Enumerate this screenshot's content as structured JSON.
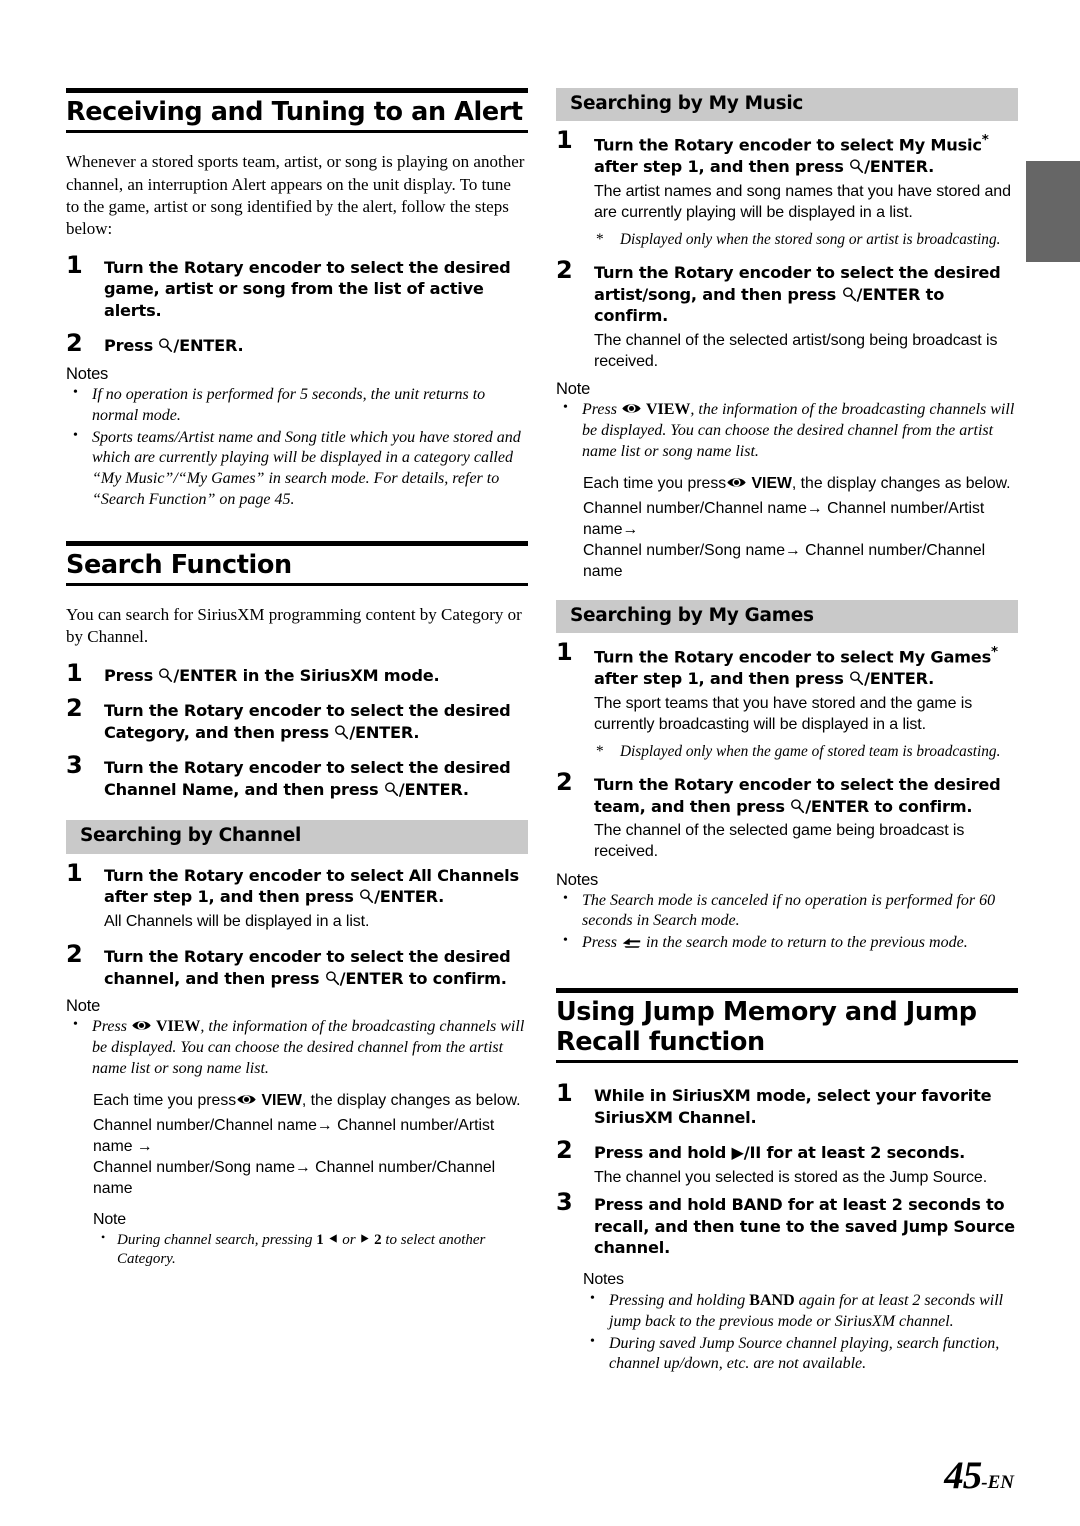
{
  "page": {
    "number": "45",
    "suffix": "-EN"
  },
  "left_column": {
    "chapter_alert": {
      "title": "Receiving and Tuning to an Alert",
      "intro": "Whenever a stored sports team, artist, or song is playing on another channel, an interruption Alert appears on the unit display. To tune to the game, artist or song identified by the alert, follow the steps below:",
      "step1": {
        "num": "1",
        "text_a": "Turn the ",
        "bold_a": "Rotary encoder",
        "text_b": " to select the desired game, artist or song from the list of active alerts."
      },
      "step2": {
        "num": "2",
        "press": "Press ",
        "enter": "/ENTER."
      },
      "notes_title": "Notes",
      "notes": [
        "If no operation is performed for 5 seconds, the unit returns to normal mode.",
        "Sports teams/Artist name and Song title which you have stored and which are currently playing will be displayed in a category called “My Music”/“My Games” in search mode. For details, refer to “Search Function” on page 45."
      ]
    },
    "chapter_search": {
      "title": "Search Function",
      "intro": "You can search for SiriusXM programming content by Category or by Channel.",
      "step1": {
        "num": "1",
        "press": "Press ",
        "enter": "/ENTER in the SiriusXM mode."
      },
      "step2": {
        "num": "2",
        "text_a": "Turn the ",
        "bold_a": "Rotary encoder",
        "text_b": " to select the desired Category, and then press ",
        "enter": "/ENTER."
      },
      "step3": {
        "num": "3",
        "text_a": "Turn the ",
        "bold_a": "Rotary encoder",
        "text_b": " to select the desired Channel Name, and then press ",
        "enter": "/ENTER."
      }
    },
    "section_channel": {
      "title": "Searching by Channel",
      "step1": {
        "num": "1",
        "text_a": "Turn the ",
        "bold_a": "Rotary encoder",
        "text_b": " to select All Channels after step 1, and then press ",
        "enter": "/ENTER.",
        "sub": "All Channels will be displayed in a list."
      },
      "step2": {
        "num": "2",
        "text_a": "Turn the ",
        "bold_a": "Rotary encoder",
        "text_b": " to select the desired channel, and then press ",
        "enter": "/ENTER to confirm."
      },
      "note_title": "Note",
      "note_press": "Press ",
      "note_view_label": "VIEW",
      "note_body": ", the information of the broadcasting channels will be displayed. You can choose the desired channel from the artist name list or song name list.",
      "each_time_a": "Each time you press",
      "each_time_view": "VIEW",
      "each_time_b": ", the display changes as below.",
      "flow_line1": "Channel number/Channel name→ Channel number/Artist name →",
      "flow_line2": "Channel number/Song name→ Channel number/Channel name",
      "nested_note_title": "Note",
      "nested_note_a": "During channel search, pressing ",
      "nested_note_one": "1",
      "nested_note_or": " or ",
      "nested_note_two": "2",
      "nested_note_b": " to select another Category."
    }
  },
  "right_column": {
    "section_my_music": {
      "title": "Searching by My Music",
      "step1": {
        "num": "1",
        "text_a": "Turn the ",
        "bold_a": "Rotary encoder",
        "text_b": " to select My Music",
        "star": "*",
        "text_c": " after step 1, and then press ",
        "enter": "/ENTER.",
        "sub": "The artist names and song names that you have stored and are currently playing will be displayed in a list.",
        "footnote": "Displayed only when the stored song or artist is broadcasting."
      },
      "step2": {
        "num": "2",
        "text_a": "Turn the ",
        "bold_a": "Rotary encoder",
        "text_b": " to select the desired artist/song, and then press ",
        "enter": "/ENTER to confirm.",
        "sub": "The channel of the selected artist/song being broadcast is received."
      },
      "note_title": "Note",
      "note_press": "Press ",
      "note_view_label": "VIEW",
      "note_body": ", the information of the broadcasting channels will be displayed. You can choose the desired channel from the artist name list or song name list.",
      "each_time_a": "Each time you press",
      "each_time_view": "VIEW",
      "each_time_b": ", the display changes as below.",
      "flow_line1": "Channel number/Channel name→ Channel number/Artist name→",
      "flow_line2": "Channel number/Song name→ Channel number/Channel name"
    },
    "section_my_games": {
      "title": "Searching by My Games",
      "step1": {
        "num": "1",
        "text_a": "Turn the ",
        "bold_a": "Rotary encoder",
        "text_b": " to select My Games",
        "star": "*",
        "text_c": " after step 1, and then press ",
        "enter": "/ENTER.",
        "sub": "The sport teams that you have stored and the game is currently broadcasting will be displayed in a list.",
        "footnote": "Displayed only when the game of stored team is broadcasting."
      },
      "step2": {
        "num": "2",
        "text_a": "Turn the ",
        "bold_a": "Rotary encoder",
        "text_b": " to select the desired team, and then press ",
        "enter": "/ENTER to confirm.",
        "sub": "The channel of the selected game being broadcast is received."
      },
      "notes_title": "Notes",
      "note1": "The Search mode is canceled if no operation is performed for 60 seconds in Search mode.",
      "note2_a": "Press ",
      "note2_b": " in the search mode to return to the previous mode."
    },
    "chapter_jump": {
      "title": "Using Jump Memory and Jump Recall function",
      "step1": {
        "num": "1",
        "text": "While in SiriusXM mode, select your favorite SiriusXM Channel."
      },
      "step2": {
        "num": "2",
        "text_a": "Press and hold ",
        "symbol": "▶/II",
        "text_b": " for at least 2 seconds.",
        "sub": "The channel you selected is stored as the Jump Source."
      },
      "step3": {
        "num": "3",
        "text_a": "Press and hold ",
        "bold_a": "BAND",
        "text_b": " for at least 2 seconds to recall, and then tune to the saved Jump Source channel."
      },
      "notes_title": "Notes",
      "note1_a": "Pressing and holding ",
      "note1_bold": "BAND",
      "note1_b": " again for at least 2 seconds will jump back to the previous mode or SiriusXM channel.",
      "note2": "During saved Jump Source channel playing, search function, channel up/down, etc. are not available."
    }
  },
  "icons": {
    "search": "search-icon",
    "view": "view-eye-icon",
    "back": "back-return-icon",
    "tri_left": "triangle-left-icon",
    "tri_right": "triangle-right-icon"
  },
  "colors": {
    "section_bar": "#c9c9c9",
    "bleed_tab": "#666666",
    "rule": "#000000"
  }
}
